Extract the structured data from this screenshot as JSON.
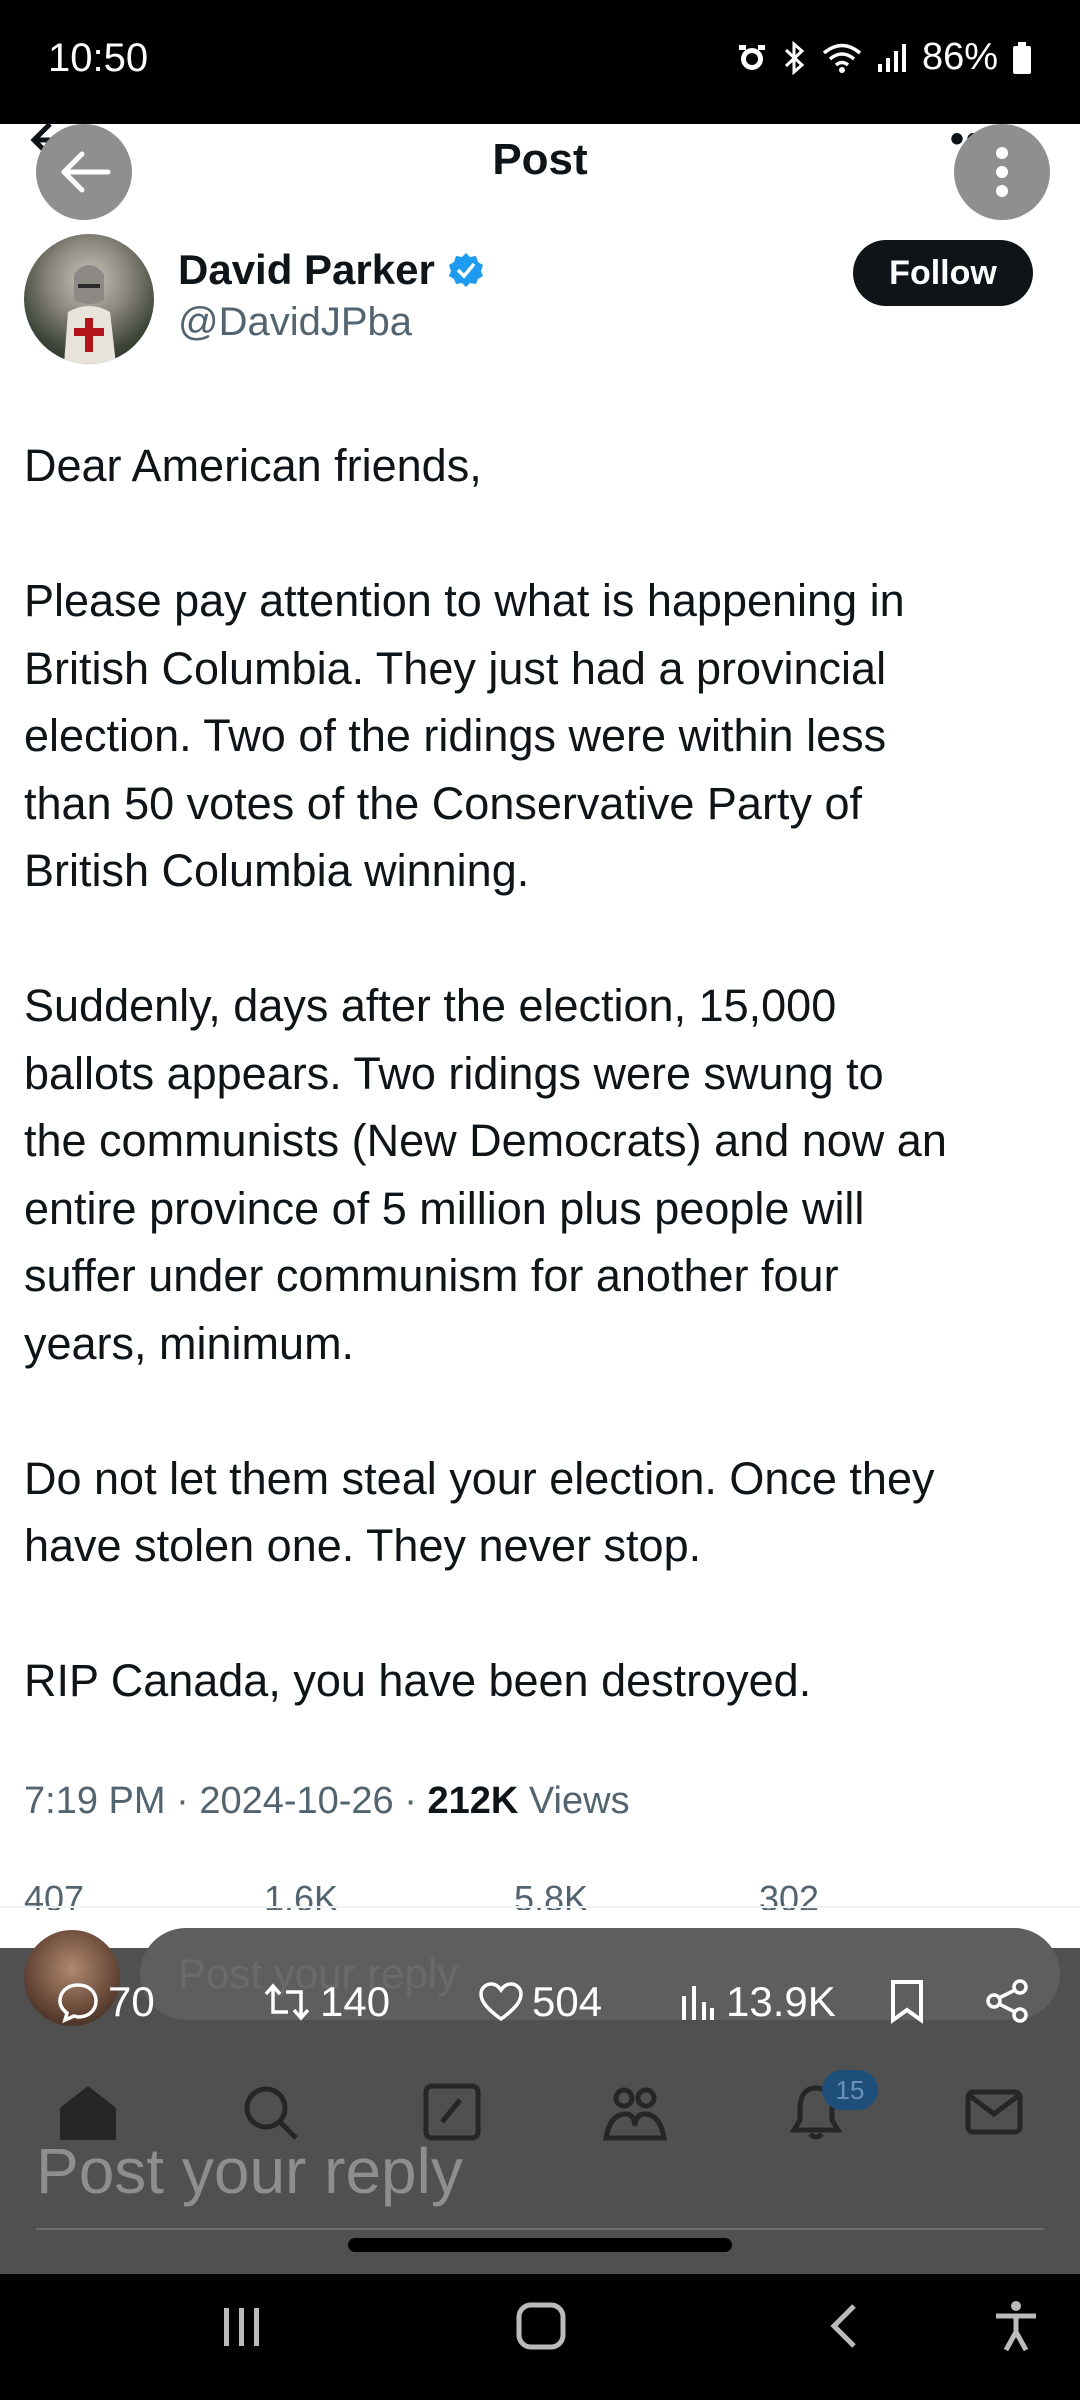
{
  "status_bar": {
    "time": "10:50",
    "battery": "86%",
    "icons": [
      "alarm-icon",
      "bluetooth-icon",
      "wifi-icon",
      "signal-icon",
      "battery-icon"
    ]
  },
  "header": {
    "title": "Post"
  },
  "author": {
    "name": "David Parker",
    "handle": "@DavidJPba",
    "verified": true,
    "follow_label": "Follow"
  },
  "post": {
    "paragraphs": [
      [
        "Dear American friends,"
      ],
      [
        "Please pay attention to what is happening in",
        "British Columbia. They just had a provincial",
        "election. Two of the ridings were within less",
        "than 50 votes of the Conservative Party of",
        "British Columbia winning."
      ],
      [
        "Suddenly, days after the election, 15,000",
        "ballots appears. Two ridings were swung to",
        "the communists (New Democrats) and now an",
        "entire province of 5 million plus people will",
        "suffer under communism for another four",
        "years, minimum."
      ],
      [
        "Do not let them steal your election. Once they",
        "have stolen one. They never stop."
      ],
      [
        "RIP Canada, you have been destroyed."
      ]
    ],
    "meta_time": "7:19 PM",
    "meta_date": "2024-10-26",
    "meta_views_count": "212K",
    "meta_views_label": "Views"
  },
  "faded_stats": {
    "replies": "407",
    "reposts": "1.6K",
    "likes": "5.8K",
    "bookmarks": "302"
  },
  "reply_box": {
    "placeholder": "Post your reply"
  },
  "overlay_stats": {
    "replies": "70",
    "reposts": "140",
    "likes": "504",
    "views": "13.9K"
  },
  "nav": {
    "notifications_badge": "15"
  },
  "big_reply": {
    "placeholder": "Post your reply"
  },
  "colors": {
    "verified": "#1d9bf0",
    "text_primary": "#0f1419",
    "text_secondary": "#536471",
    "overlay": "#505050"
  }
}
